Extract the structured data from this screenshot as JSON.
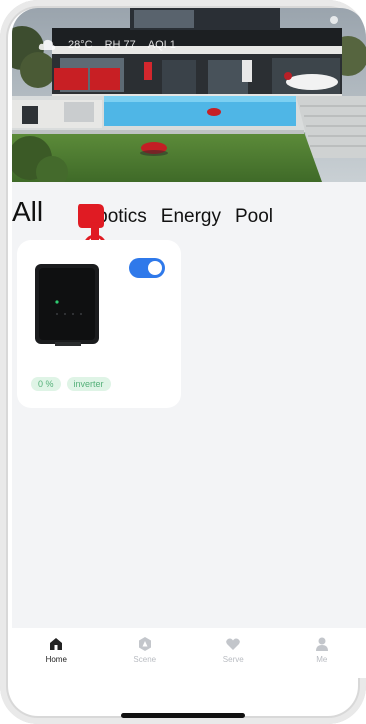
{
  "hero": {
    "status_text": "  ",
    "weather": {
      "temperature": "28°C",
      "humidity": "RH 77",
      "air_quality": "AQI 1"
    }
  },
  "tabs": [
    {
      "label": "All"
    },
    {
      "label": "Robotics"
    },
    {
      "label": "Energy"
    },
    {
      "label": "Pool"
    }
  ],
  "tab_visible": {
    "all": "All",
    "robotics": "botics",
    "energy": "Energy",
    "pool": "Pool"
  },
  "device_card": {
    "enabled": true,
    "tags": [
      "0 %",
      "inverter"
    ]
  },
  "bottom_nav": [
    {
      "label": "Home",
      "icon": "home-icon"
    },
    {
      "label": "Scene",
      "icon": "scene-icon"
    },
    {
      "label": "Serve",
      "icon": "heart-icon"
    },
    {
      "label": "Me",
      "icon": "user-icon"
    }
  ],
  "colors": {
    "accent": "#2f79ea",
    "tag_bg": "#dff4e6",
    "tag_text": "#55b079",
    "pointer": "#e01b23"
  }
}
